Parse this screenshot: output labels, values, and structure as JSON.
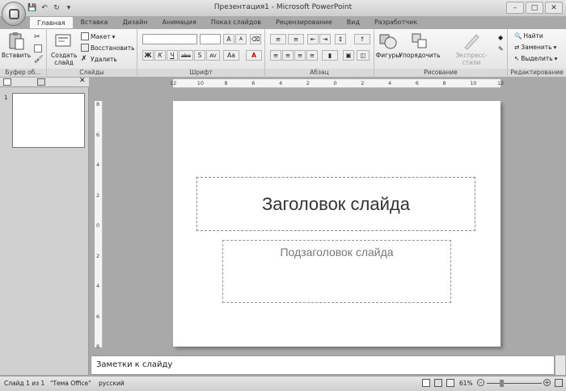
{
  "window": {
    "title": "Презентация1 - Microsoft PowerPoint"
  },
  "qat": {
    "save_icon": "save-icon",
    "undo_icon": "undo-icon",
    "redo_icon": "redo-icon"
  },
  "tabs": [
    "Главная",
    "Вставка",
    "Дизайн",
    "Анимация",
    "Показ слайдов",
    "Рецензирование",
    "Вид",
    "Разработчик"
  ],
  "ribbon": {
    "clipboard": {
      "label": "Буфер об...",
      "paste": "Вставить"
    },
    "slides": {
      "label": "Слайды",
      "new_slide": "Создать слайд",
      "layout": "Макет",
      "reset": "Восстановить",
      "delete": "Удалить"
    },
    "font": {
      "label": "Шрифт",
      "bold": "Ж",
      "italic": "К",
      "underline": "Ч",
      "strike": "abe",
      "shadow": "S",
      "spacing": "AV",
      "case": "Aa",
      "grow": "A",
      "shrink": "A",
      "color": "A"
    },
    "paragraph": {
      "label": "Абзац"
    },
    "drawing": {
      "label": "Рисование",
      "shapes": "Фигуры",
      "arrange": "Упорядочить",
      "quick_styles": "Экспресс-стили"
    },
    "editing": {
      "label": "Редактирование",
      "find": "Найти",
      "replace": "Заменить",
      "select": "Выделить"
    }
  },
  "ruler": {
    "h_labels": [
      "12",
      "10",
      "8",
      "6",
      "4",
      "2",
      "0",
      "2",
      "4",
      "6",
      "8",
      "10",
      "12"
    ],
    "v_labels": [
      "8",
      "6",
      "4",
      "2",
      "0",
      "2",
      "4",
      "6",
      "8"
    ]
  },
  "slide_pane": {
    "thumb_number": "1"
  },
  "slide": {
    "title_placeholder": "Заголовок слайда",
    "subtitle_placeholder": "Подзаголовок слайда"
  },
  "notes": {
    "placeholder": "Заметки к слайду"
  },
  "status": {
    "slide": "Слайд 1 из 1",
    "theme": "\"Тема Office\"",
    "language": "русский",
    "zoom": "61%"
  },
  "colors": {
    "ribbon_bg": "#ececec",
    "workspace": "#a9a9a9"
  }
}
